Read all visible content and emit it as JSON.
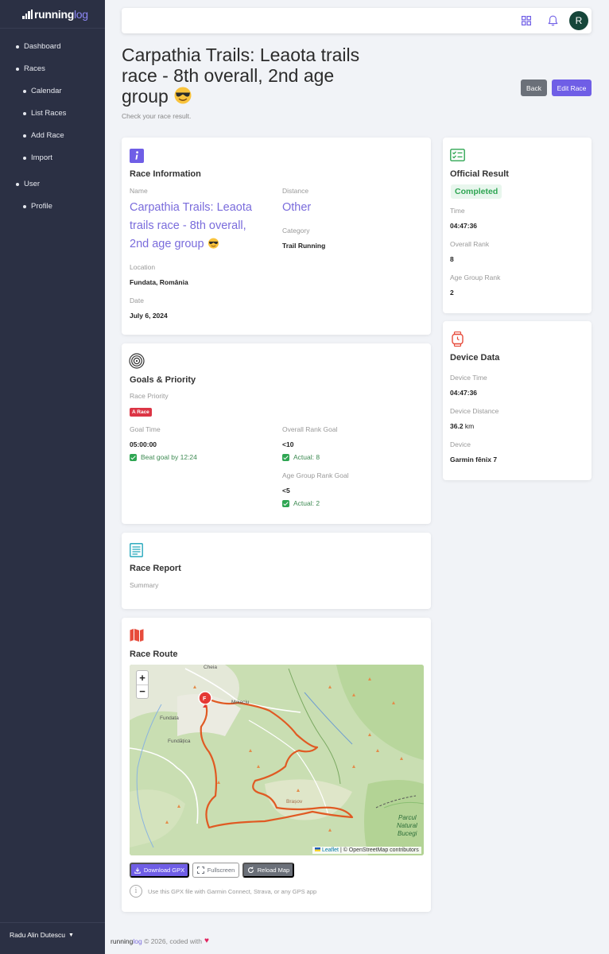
{
  "brand": {
    "name_a": "running",
    "name_b": "log"
  },
  "sidebar": {
    "items": [
      {
        "label": "Dashboard"
      },
      {
        "label": "Races"
      },
      {
        "label": "Calendar"
      },
      {
        "label": "List Races"
      },
      {
        "label": "Add Race"
      },
      {
        "label": "Import"
      },
      {
        "label": "User"
      },
      {
        "label": "Profile"
      }
    ],
    "user_name": "Radu Alin Dutescu"
  },
  "topbar": {
    "avatar_letter": "R",
    "icons": [
      "grid-icon",
      "bell-icon"
    ]
  },
  "header": {
    "title": "Carpathia Trails: Leaota trails race - 8th overall, 2nd age group",
    "subtitle": "Check your race result.",
    "back_label": "Back",
    "edit_label": "Edit Race"
  },
  "race_info": {
    "title": "Race Information",
    "name_label": "Name",
    "name_value": "Carpathia Trails: Leaota trails race - 8th overall, 2nd age group",
    "distance_label": "Distance",
    "distance_value": "Other",
    "category_label": "Category",
    "category_value": "Trail Running",
    "location_label": "Location",
    "location_value": "Fundata, România",
    "date_label": "Date",
    "date_value": "July 6, 2024"
  },
  "official_result": {
    "title": "Official Result",
    "status": "Completed",
    "time_label": "Time",
    "time_value": "04:47:36",
    "overall_label": "Overall Rank",
    "overall_value": "8",
    "age_label": "Age Group Rank",
    "age_value": "2"
  },
  "device": {
    "title": "Device Data",
    "time_label": "Device Time",
    "time_value": "04:47:36",
    "distance_label": "Device Distance",
    "distance_value": "36.2",
    "distance_unit": "km",
    "device_label": "Device",
    "device_value": "Garmin fēnix 7"
  },
  "goals": {
    "title": "Goals & Priority",
    "priority_label": "Race Priority",
    "priority_badge": "A Race",
    "goal_time_label": "Goal Time",
    "goal_time_value": "05:00:00",
    "goal_time_result": "Beat goal by 12:24",
    "overall_goal_label": "Overall Rank Goal",
    "overall_goal_value": "<10",
    "overall_goal_result": "Actual: 8",
    "age_goal_label": "Age Group Rank Goal",
    "age_goal_value": "<5",
    "age_goal_result": "Actual: 2"
  },
  "report": {
    "title": "Race Report",
    "summary_label": "Summary"
  },
  "route": {
    "title": "Race Route",
    "map_labels": [
      "Cheia",
      "Moieciu",
      "Fundata",
      "Fundățica",
      "Brașov",
      "Parcul",
      "Natural",
      "Bucegi"
    ],
    "marker_label": "F",
    "attribution_leaflet": "Leaflet",
    "attribution_rest": "| © OpenStreetMap contributors",
    "download_label": "Download GPX",
    "fullscreen_label": "Fullscreen",
    "reload_label": "Reload Map",
    "note": "Use this GPX file with Garmin Connect, Strava, or any GPS app"
  },
  "footer": {
    "brand_a": "running",
    "brand_b": "log",
    "text": "© 2026, coded with"
  },
  "colors": {
    "accent": "#6f5ee6",
    "sidebar": "#2b3044",
    "success": "#2fa653",
    "danger": "#dc3545"
  }
}
